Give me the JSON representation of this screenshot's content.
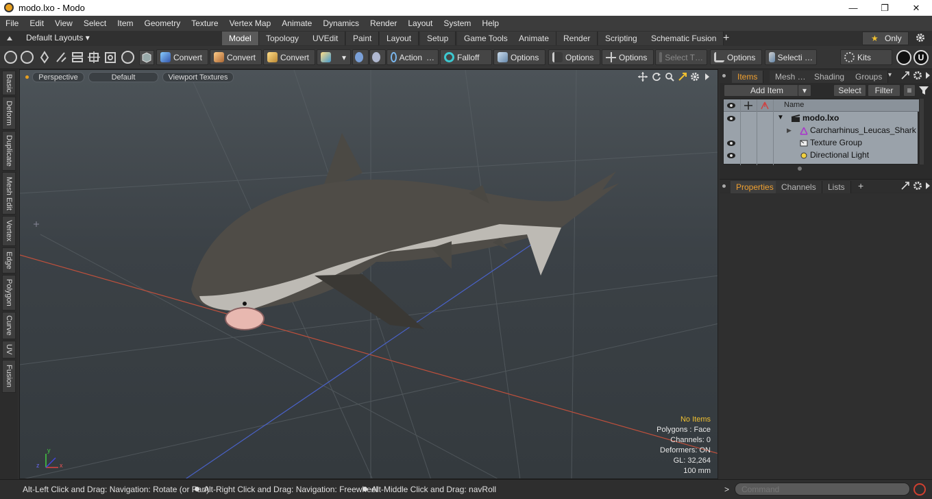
{
  "window": {
    "title": "modo.lxo - Modo",
    "minimize": "—",
    "maximize": "❐",
    "close": "✕"
  },
  "menu": [
    "File",
    "Edit",
    "View",
    "Select",
    "Item",
    "Geometry",
    "Texture",
    "Vertex Map",
    "Animate",
    "Dynamics",
    "Render",
    "Layout",
    "System",
    "Help"
  ],
  "layouts": {
    "selector": "Default Layouts ▾",
    "tabs": [
      "Model",
      "Topology",
      "UVEdit",
      "Paint",
      "Layout",
      "Setup",
      "Game Tools",
      "Animate",
      "Render",
      "Scripting",
      "Schematic Fusion"
    ],
    "active": "Model",
    "add": "+",
    "only": "Only",
    "star": "★"
  },
  "toolbar": {
    "convert1": "Convert",
    "convert2": "Convert",
    "convert3": "Convert",
    "action": "Action",
    "action_more": "…",
    "falloff": "Falloff",
    "options1": "Options",
    "options2": "Options",
    "options3": "Options",
    "select_t": "Select T…",
    "options4": "Options",
    "selecti": "Selecti …",
    "kits": "Kits"
  },
  "left_tabs": [
    "Basic",
    "Deform",
    "Duplicate",
    "Mesh Edit",
    "Vertex",
    "Edge",
    "Polygon",
    "Curve",
    "UV",
    "Fusion"
  ],
  "viewport": {
    "view": "Perspective",
    "shading": "Default",
    "textures": "Viewport Textures",
    "info": {
      "items": "No Items",
      "polygons": "Polygons : Face",
      "channels": "Channels: 0",
      "deformers": "Deformers: ON",
      "gl": "GL: 32,264",
      "scale": "100 mm"
    },
    "axis": {
      "x": "x",
      "y": "y",
      "z": "z"
    }
  },
  "items_panel": {
    "tabs": [
      "Items",
      "Mesh …",
      "Shading",
      "Groups"
    ],
    "active_tab": "Items",
    "add_item": "Add Item",
    "select": "Select",
    "filter": "Filter",
    "column_name": "Name",
    "rows": [
      {
        "name": "modo.lxo",
        "bold": true
      },
      {
        "name": "Carcharhinus_Leucas_Shark"
      },
      {
        "name": "Texture Group"
      },
      {
        "name": "Directional Light"
      }
    ]
  },
  "properties_panel": {
    "tabs": [
      "Properties",
      "Channels",
      "Lists"
    ],
    "active_tab": "Properties",
    "add": "+"
  },
  "status": {
    "hint1": "Alt-Left Click and Drag: Navigation: Rotate (or Pan)",
    "hint2": "Alt-Right Click and Drag: Navigation: Freewheel",
    "hint3": "Alt-Middle Click and Drag: navRoll",
    "command_placeholder": "Command",
    "prompt": ">"
  },
  "colors": {
    "accent": "#f0a030",
    "active_tab": "#5a5a5a",
    "viewport_bg": "#3b4146",
    "grid_red": "#c0503c",
    "grid_blue": "#4a62c8"
  }
}
